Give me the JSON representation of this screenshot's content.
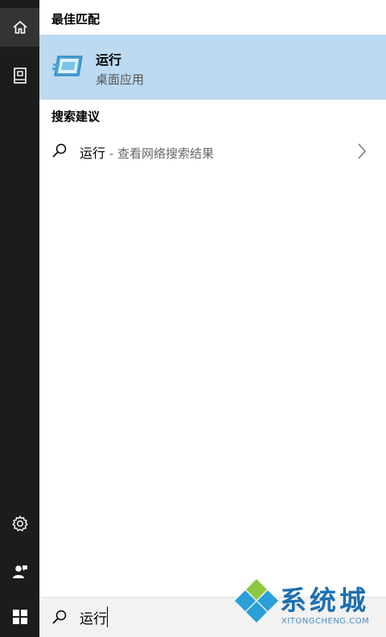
{
  "rail": {
    "items": [
      {
        "icon": "home-icon",
        "active": true
      },
      {
        "icon": "notebook-icon",
        "active": false
      }
    ],
    "bottom_items": [
      {
        "icon": "gear-icon"
      },
      {
        "icon": "user-feedback-icon"
      }
    ]
  },
  "best_match": {
    "section_title": "最佳匹配",
    "app_name": "运行",
    "app_type": "桌面应用",
    "app_icon": "run-app-icon",
    "highlight_color": "#bcdaf2"
  },
  "suggestions": {
    "section_title": "搜索建议",
    "items": [
      {
        "term": "运行",
        "sub": " - 查看网络搜索结果"
      }
    ]
  },
  "search": {
    "value": "运行"
  },
  "watermark": {
    "title": "系统城",
    "subtitle": "XITONGCHENG.COM"
  }
}
